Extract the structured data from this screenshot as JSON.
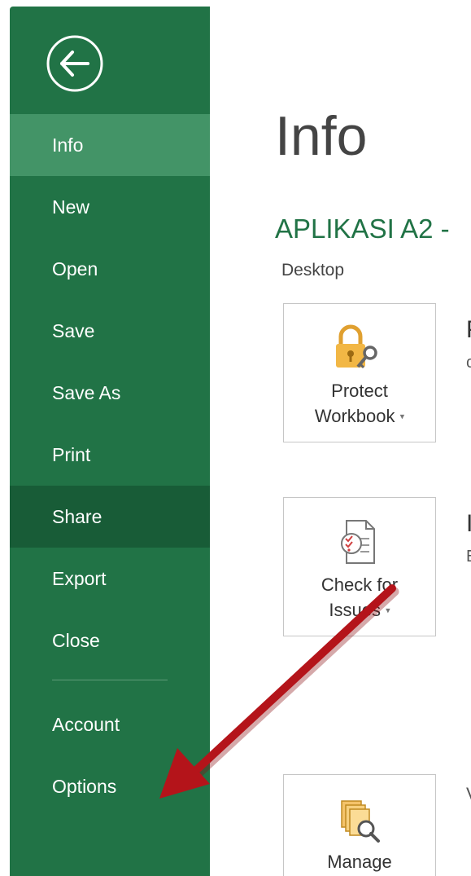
{
  "sidebar": {
    "items": [
      {
        "label": "Info",
        "state": "active"
      },
      {
        "label": "New"
      },
      {
        "label": "Open"
      },
      {
        "label": "Save"
      },
      {
        "label": "Save As"
      },
      {
        "label": "Print"
      },
      {
        "label": "Share",
        "state": "selected"
      },
      {
        "label": "Export"
      },
      {
        "label": "Close"
      }
    ],
    "bottom_items": [
      {
        "label": "Account"
      },
      {
        "label": "Options"
      }
    ]
  },
  "main": {
    "title": "Info",
    "document_name": "APLIKASI A2 -",
    "document_location": "Desktop",
    "protect": {
      "line1": "Protect",
      "line2": "Workbook"
    },
    "check": {
      "line1": "Check for",
      "line2": "Issues"
    },
    "manage": {
      "line1": "Manage"
    },
    "cut_letters": {
      "p1": "P",
      "p2": "c",
      "i1": "I",
      "i2": "E",
      "v": "V"
    }
  },
  "colors": {
    "sidebar": "#217346",
    "sidebar_active": "#439467",
    "sidebar_selected": "#185c37",
    "doc_name": "#217346",
    "annotation_arrow": "#b4141a"
  },
  "icons": {
    "back": "back-arrow-icon",
    "protect": "lock-key-icon",
    "check": "inspect-document-icon",
    "manage": "manage-versions-icon"
  }
}
